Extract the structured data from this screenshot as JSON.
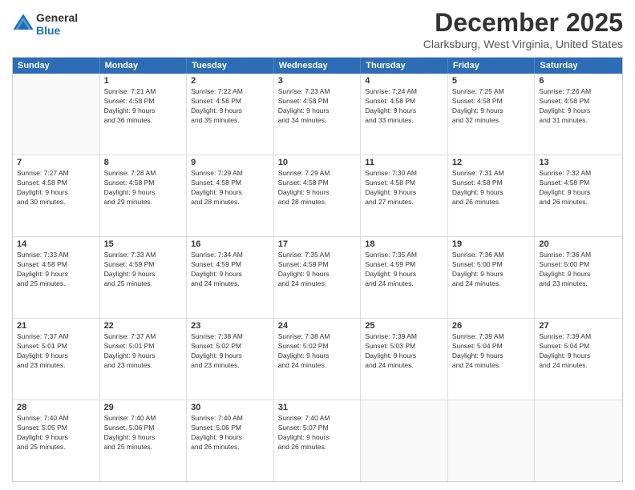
{
  "header": {
    "logo_line1": "General",
    "logo_line2": "Blue",
    "month_title": "December 2025",
    "location": "Clarksburg, West Virginia, United States"
  },
  "day_headers": [
    "Sunday",
    "Monday",
    "Tuesday",
    "Wednesday",
    "Thursday",
    "Friday",
    "Saturday"
  ],
  "weeks": [
    [
      {
        "day": "",
        "info": ""
      },
      {
        "day": "1",
        "info": "Sunrise: 7:21 AM\nSunset: 4:58 PM\nDaylight: 9 hours\nand 36 minutes."
      },
      {
        "day": "2",
        "info": "Sunrise: 7:22 AM\nSunset: 4:58 PM\nDaylight: 9 hours\nand 35 minutes."
      },
      {
        "day": "3",
        "info": "Sunrise: 7:23 AM\nSunset: 4:58 PM\nDaylight: 9 hours\nand 34 minutes."
      },
      {
        "day": "4",
        "info": "Sunrise: 7:24 AM\nSunset: 4:58 PM\nDaylight: 9 hours\nand 33 minutes."
      },
      {
        "day": "5",
        "info": "Sunrise: 7:25 AM\nSunset: 4:58 PM\nDaylight: 9 hours\nand 32 minutes."
      },
      {
        "day": "6",
        "info": "Sunrise: 7:26 AM\nSunset: 4:58 PM\nDaylight: 9 hours\nand 31 minutes."
      }
    ],
    [
      {
        "day": "7",
        "info": "Sunrise: 7:27 AM\nSunset: 4:58 PM\nDaylight: 9 hours\nand 30 minutes."
      },
      {
        "day": "8",
        "info": "Sunrise: 7:28 AM\nSunset: 4:58 PM\nDaylight: 9 hours\nand 29 minutes."
      },
      {
        "day": "9",
        "info": "Sunrise: 7:29 AM\nSunset: 4:58 PM\nDaylight: 9 hours\nand 28 minutes."
      },
      {
        "day": "10",
        "info": "Sunrise: 7:29 AM\nSunset: 4:58 PM\nDaylight: 9 hours\nand 28 minutes."
      },
      {
        "day": "11",
        "info": "Sunrise: 7:30 AM\nSunset: 4:58 PM\nDaylight: 9 hours\nand 27 minutes."
      },
      {
        "day": "12",
        "info": "Sunrise: 7:31 AM\nSunset: 4:58 PM\nDaylight: 9 hours\nand 26 minutes."
      },
      {
        "day": "13",
        "info": "Sunrise: 7:32 AM\nSunset: 4:58 PM\nDaylight: 9 hours\nand 26 minutes."
      }
    ],
    [
      {
        "day": "14",
        "info": "Sunrise: 7:33 AM\nSunset: 4:58 PM\nDaylight: 9 hours\nand 25 minutes."
      },
      {
        "day": "15",
        "info": "Sunrise: 7:33 AM\nSunset: 4:59 PM\nDaylight: 9 hours\nand 25 minutes."
      },
      {
        "day": "16",
        "info": "Sunrise: 7:34 AM\nSunset: 4:59 PM\nDaylight: 9 hours\nand 24 minutes."
      },
      {
        "day": "17",
        "info": "Sunrise: 7:35 AM\nSunset: 4:59 PM\nDaylight: 9 hours\nand 24 minutes."
      },
      {
        "day": "18",
        "info": "Sunrise: 7:35 AM\nSunset: 4:59 PM\nDaylight: 9 hours\nand 24 minutes."
      },
      {
        "day": "19",
        "info": "Sunrise: 7:36 AM\nSunset: 5:00 PM\nDaylight: 9 hours\nand 24 minutes."
      },
      {
        "day": "20",
        "info": "Sunrise: 7:36 AM\nSunset: 5:00 PM\nDaylight: 9 hours\nand 23 minutes."
      }
    ],
    [
      {
        "day": "21",
        "info": "Sunrise: 7:37 AM\nSunset: 5:01 PM\nDaylight: 9 hours\nand 23 minutes."
      },
      {
        "day": "22",
        "info": "Sunrise: 7:37 AM\nSunset: 5:01 PM\nDaylight: 9 hours\nand 23 minutes."
      },
      {
        "day": "23",
        "info": "Sunrise: 7:38 AM\nSunset: 5:02 PM\nDaylight: 9 hours\nand 23 minutes."
      },
      {
        "day": "24",
        "info": "Sunrise: 7:38 AM\nSunset: 5:02 PM\nDaylight: 9 hours\nand 24 minutes."
      },
      {
        "day": "25",
        "info": "Sunrise: 7:39 AM\nSunset: 5:03 PM\nDaylight: 9 hours\nand 24 minutes."
      },
      {
        "day": "26",
        "info": "Sunrise: 7:39 AM\nSunset: 5:04 PM\nDaylight: 9 hours\nand 24 minutes."
      },
      {
        "day": "27",
        "info": "Sunrise: 7:39 AM\nSunset: 5:04 PM\nDaylight: 9 hours\nand 24 minutes."
      }
    ],
    [
      {
        "day": "28",
        "info": "Sunrise: 7:40 AM\nSunset: 5:05 PM\nDaylight: 9 hours\nand 25 minutes."
      },
      {
        "day": "29",
        "info": "Sunrise: 7:40 AM\nSunset: 5:06 PM\nDaylight: 9 hours\nand 25 minutes."
      },
      {
        "day": "30",
        "info": "Sunrise: 7:40 AM\nSunset: 5:06 PM\nDaylight: 9 hours\nand 26 minutes."
      },
      {
        "day": "31",
        "info": "Sunrise: 7:40 AM\nSunset: 5:07 PM\nDaylight: 9 hours\nand 26 minutes."
      },
      {
        "day": "",
        "info": ""
      },
      {
        "day": "",
        "info": ""
      },
      {
        "day": "",
        "info": ""
      }
    ]
  ]
}
